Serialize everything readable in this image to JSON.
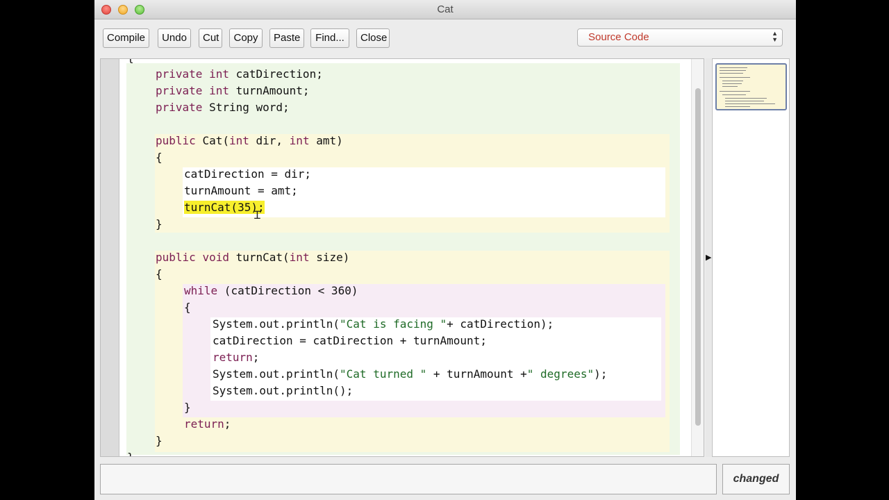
{
  "window": {
    "title": "Cat"
  },
  "toolbar": {
    "buttons": [
      "Compile",
      "Undo",
      "Cut",
      "Copy",
      "Paste",
      "Find...",
      "Close"
    ],
    "view_select": "Source Code",
    "view_select_icon": "up-down-arrows-icon"
  },
  "editor": {
    "lines": [
      {
        "indent": 0,
        "tokens": [
          {
            "t": "{"
          }
        ]
      },
      {
        "indent": 1,
        "tokens": [
          {
            "t": "private ",
            "k": "kw"
          },
          {
            "t": "int",
            "k": "kw"
          },
          {
            "t": " catDirection;"
          }
        ]
      },
      {
        "indent": 1,
        "tokens": [
          {
            "t": "private ",
            "k": "kw"
          },
          {
            "t": "int",
            "k": "kw"
          },
          {
            "t": " turnAmount;"
          }
        ]
      },
      {
        "indent": 1,
        "tokens": [
          {
            "t": "private ",
            "k": "kw"
          },
          {
            "t": "String word;"
          }
        ]
      },
      {
        "indent": 1,
        "tokens": []
      },
      {
        "indent": 1,
        "tokens": [
          {
            "t": "public ",
            "k": "kw"
          },
          {
            "t": "Cat("
          },
          {
            "t": "int",
            "k": "kw"
          },
          {
            "t": " dir, "
          },
          {
            "t": "int",
            "k": "kw"
          },
          {
            "t": " amt)"
          }
        ]
      },
      {
        "indent": 1,
        "tokens": [
          {
            "t": "{"
          }
        ]
      },
      {
        "indent": 2,
        "tokens": [
          {
            "t": "catDirection = dir;"
          }
        ]
      },
      {
        "indent": 2,
        "tokens": [
          {
            "t": "turnAmount = amt;"
          }
        ]
      },
      {
        "indent": 2,
        "tokens": [
          {
            "t": "turnCat(35);",
            "k": "hl"
          }
        ]
      },
      {
        "indent": 1,
        "tokens": [
          {
            "t": "}"
          }
        ]
      },
      {
        "indent": 1,
        "tokens": []
      },
      {
        "indent": 1,
        "tokens": [
          {
            "t": "public ",
            "k": "kw"
          },
          {
            "t": "void ",
            "k": "kw"
          },
          {
            "t": "turnCat("
          },
          {
            "t": "int",
            "k": "kw"
          },
          {
            "t": " size)"
          }
        ]
      },
      {
        "indent": 1,
        "tokens": [
          {
            "t": "{"
          }
        ]
      },
      {
        "indent": 2,
        "tokens": [
          {
            "t": "while",
            "k": "kw"
          },
          {
            "t": " (catDirection < 360)"
          }
        ]
      },
      {
        "indent": 2,
        "tokens": [
          {
            "t": "{"
          }
        ]
      },
      {
        "indent": 3,
        "tokens": [
          {
            "t": "System.out.println("
          },
          {
            "t": "\"Cat is facing \"",
            "k": "str"
          },
          {
            "t": "+ catDirection);"
          }
        ]
      },
      {
        "indent": 3,
        "tokens": [
          {
            "t": "catDirection = catDirection + turnAmount;"
          }
        ]
      },
      {
        "indent": 3,
        "tokens": [
          {
            "t": "return",
            "k": "kw"
          },
          {
            "t": ";"
          }
        ]
      },
      {
        "indent": 3,
        "tokens": [
          {
            "t": "System.out.println("
          },
          {
            "t": "\"Cat turned \"",
            "k": "str"
          },
          {
            "t": " + turnAmount +"
          },
          {
            "t": "\" degrees\"",
            "k": "str"
          },
          {
            "t": ");"
          }
        ]
      },
      {
        "indent": 3,
        "tokens": [
          {
            "t": "System.out.println();"
          }
        ]
      },
      {
        "indent": 2,
        "tokens": [
          {
            "t": "}"
          }
        ]
      },
      {
        "indent": 2,
        "tokens": [
          {
            "t": "return",
            "k": "kw"
          },
          {
            "t": ";"
          }
        ]
      },
      {
        "indent": 1,
        "tokens": [
          {
            "t": "}"
          }
        ]
      },
      {
        "indent": 0,
        "tokens": [
          {
            "t": "}"
          }
        ]
      }
    ]
  },
  "splitter_icon": "right-triangle-icon",
  "status": {
    "message": "",
    "state": "changed"
  }
}
